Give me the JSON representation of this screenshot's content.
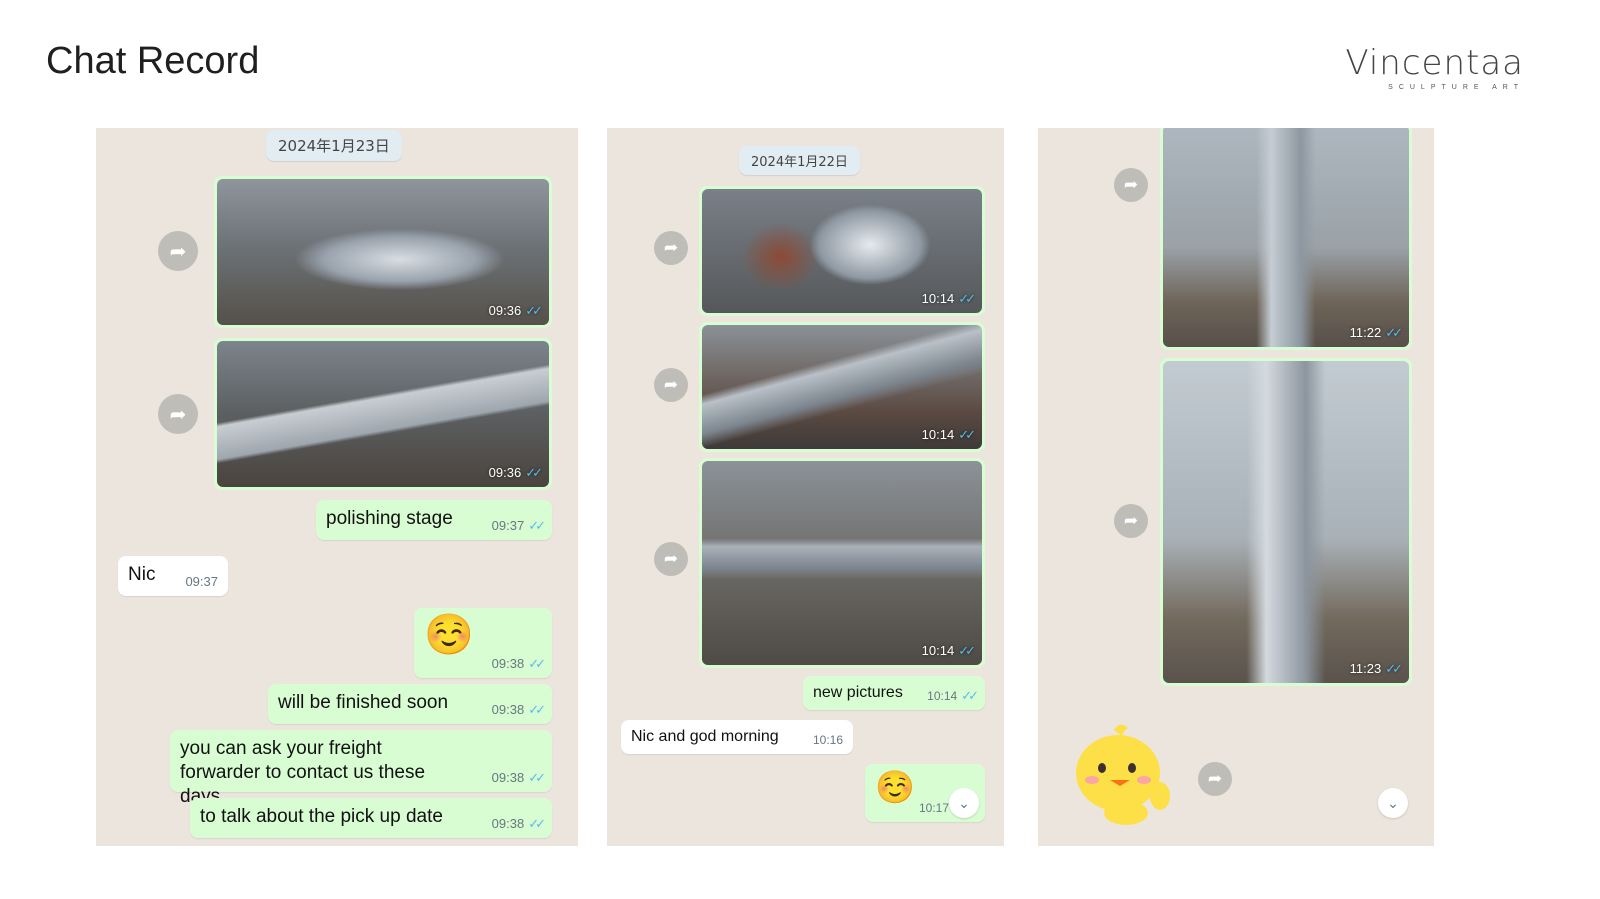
{
  "header": {
    "title": "Chat Record",
    "brand": "Vincentaa",
    "brand_sub": "SCULPTURE ART"
  },
  "panel1": {
    "date": "2024年1月23日",
    "photos": [
      {
        "time": "09:36"
      },
      {
        "time": "09:36"
      }
    ],
    "messages": [
      {
        "text": "polishing stage",
        "time": "09:37"
      },
      {
        "text": "Nic",
        "time": "09:37"
      },
      {
        "text": "☺️",
        "time": "09:38"
      },
      {
        "text": "will be finished soon",
        "time": "09:38"
      },
      {
        "text": "you can ask your freight forwarder to contact us these days",
        "time": "09:38"
      },
      {
        "text": "to talk about the pick up date",
        "time": "09:38"
      }
    ]
  },
  "panel2": {
    "date": "2024年1月22日",
    "photos": [
      {
        "time": "10:14"
      },
      {
        "time": "10:14"
      },
      {
        "time": "10:14"
      }
    ],
    "messages": [
      {
        "text": "new pictures",
        "time": "10:14"
      },
      {
        "text": "Nic and god morning",
        "time": "10:16"
      },
      {
        "text": "☺️",
        "time": "10:17"
      }
    ]
  },
  "panel3": {
    "photos": [
      {
        "time": "11:22"
      },
      {
        "time": "11:23"
      }
    ]
  },
  "colors": {
    "chat_bg": "#ece5dd",
    "outgoing": "#d9fdd3",
    "incoming": "#ffffff",
    "read_ticks": "#53bdeb"
  },
  "icons": {
    "forward": "forward-arrow-icon",
    "read": "double-check-icon",
    "scroll_down": "chevron-double-down-icon"
  }
}
